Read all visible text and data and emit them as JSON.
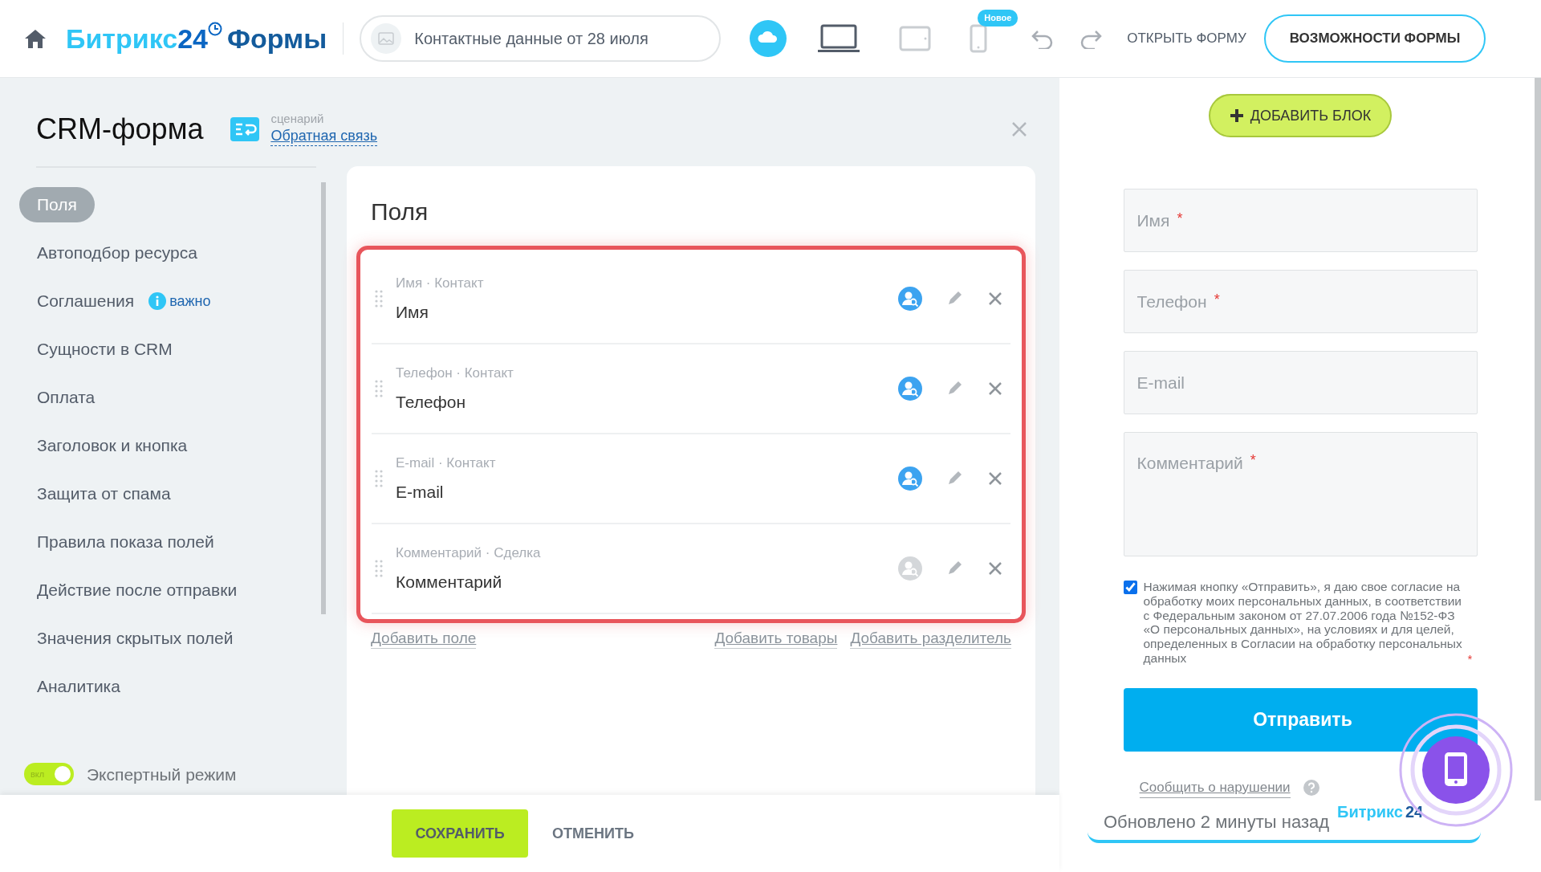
{
  "header": {
    "logo": {
      "name": "Битрикс",
      "number": "24",
      "product": "Формы"
    },
    "form_name": "Контактные данные от 28 июля",
    "devices": [
      {
        "kind": "desktop",
        "selected": true
      },
      {
        "kind": "tablet",
        "selected": false
      },
      {
        "kind": "phone",
        "selected": false,
        "badge": "Новое"
      }
    ],
    "open_form": "ОТКРЫТЬ ФОРМУ",
    "features": "ВОЗМОЖНОСТИ ФОРМЫ"
  },
  "editor": {
    "title": "CRM-форма",
    "scenario_label": "сценарий",
    "scenario": "Обратная связь"
  },
  "sidebar": {
    "items": [
      {
        "label": "Поля",
        "selected": true
      },
      {
        "label": "Автоподбор ресурса",
        "selected": false
      },
      {
        "label": "Соглашения",
        "selected": false,
        "note": "важно"
      },
      {
        "label": "Сущности в CRM",
        "selected": false
      },
      {
        "label": "Оплата",
        "selected": false
      },
      {
        "label": "Заголовок и кнопка",
        "selected": false
      },
      {
        "label": "Защита от спама",
        "selected": false
      },
      {
        "label": "Правила показа полей",
        "selected": false
      },
      {
        "label": "Действие после отправки",
        "selected": false
      },
      {
        "label": "Значения скрытых полей",
        "selected": false
      },
      {
        "label": "Аналитика",
        "selected": false
      }
    ],
    "expert_mode": {
      "switch_label": "вкл",
      "label": "Экспертный режим",
      "on": true
    }
  },
  "fields_panel": {
    "title": "Поля",
    "fields": [
      {
        "caption": "Имя · Контакт",
        "name": "Имя",
        "crm_linked": true
      },
      {
        "caption": "Телефон · Контакт",
        "name": "Телефон",
        "crm_linked": true
      },
      {
        "caption": "E-mail · Контакт",
        "name": "E-mail",
        "crm_linked": true
      },
      {
        "caption": "Комментарий · Сделка",
        "name": "Комментарий",
        "crm_linked": false
      }
    ],
    "links": [
      "Добавить поле",
      "Добавить товары",
      "Добавить разделитель"
    ]
  },
  "footer": {
    "save": "СОХРАНИТЬ",
    "cancel": "ОТМЕНИТЬ"
  },
  "preview": {
    "add_block": "ДОБАВИТЬ БЛОК",
    "inputs": [
      {
        "kind": "text",
        "placeholder": "Имя",
        "mark": "*"
      },
      {
        "kind": "text",
        "placeholder": "Телефон",
        "mark": "*"
      },
      {
        "kind": "text",
        "placeholder": "E-mail"
      },
      {
        "kind": "textarea",
        "placeholder": "Комментарий",
        "mark": "*"
      }
    ],
    "consent": {
      "checked": true,
      "text": "Нажимая кнопку «Отправить», я даю свое согласие на обработку моих персональных данных, в соответствии с Федеральным законом от 27.07.2006 года №152-ФЗ «О персональных данных», на условиях и для целей, определенных в Согласии на обработку персональных данных",
      "mark": "*"
    },
    "submit": "Отправить",
    "report": "Сообщить о нарушении",
    "brand": {
      "name": "Битрикс",
      "number": "24"
    },
    "updated": "Обновлено 2 минуты назад"
  }
}
